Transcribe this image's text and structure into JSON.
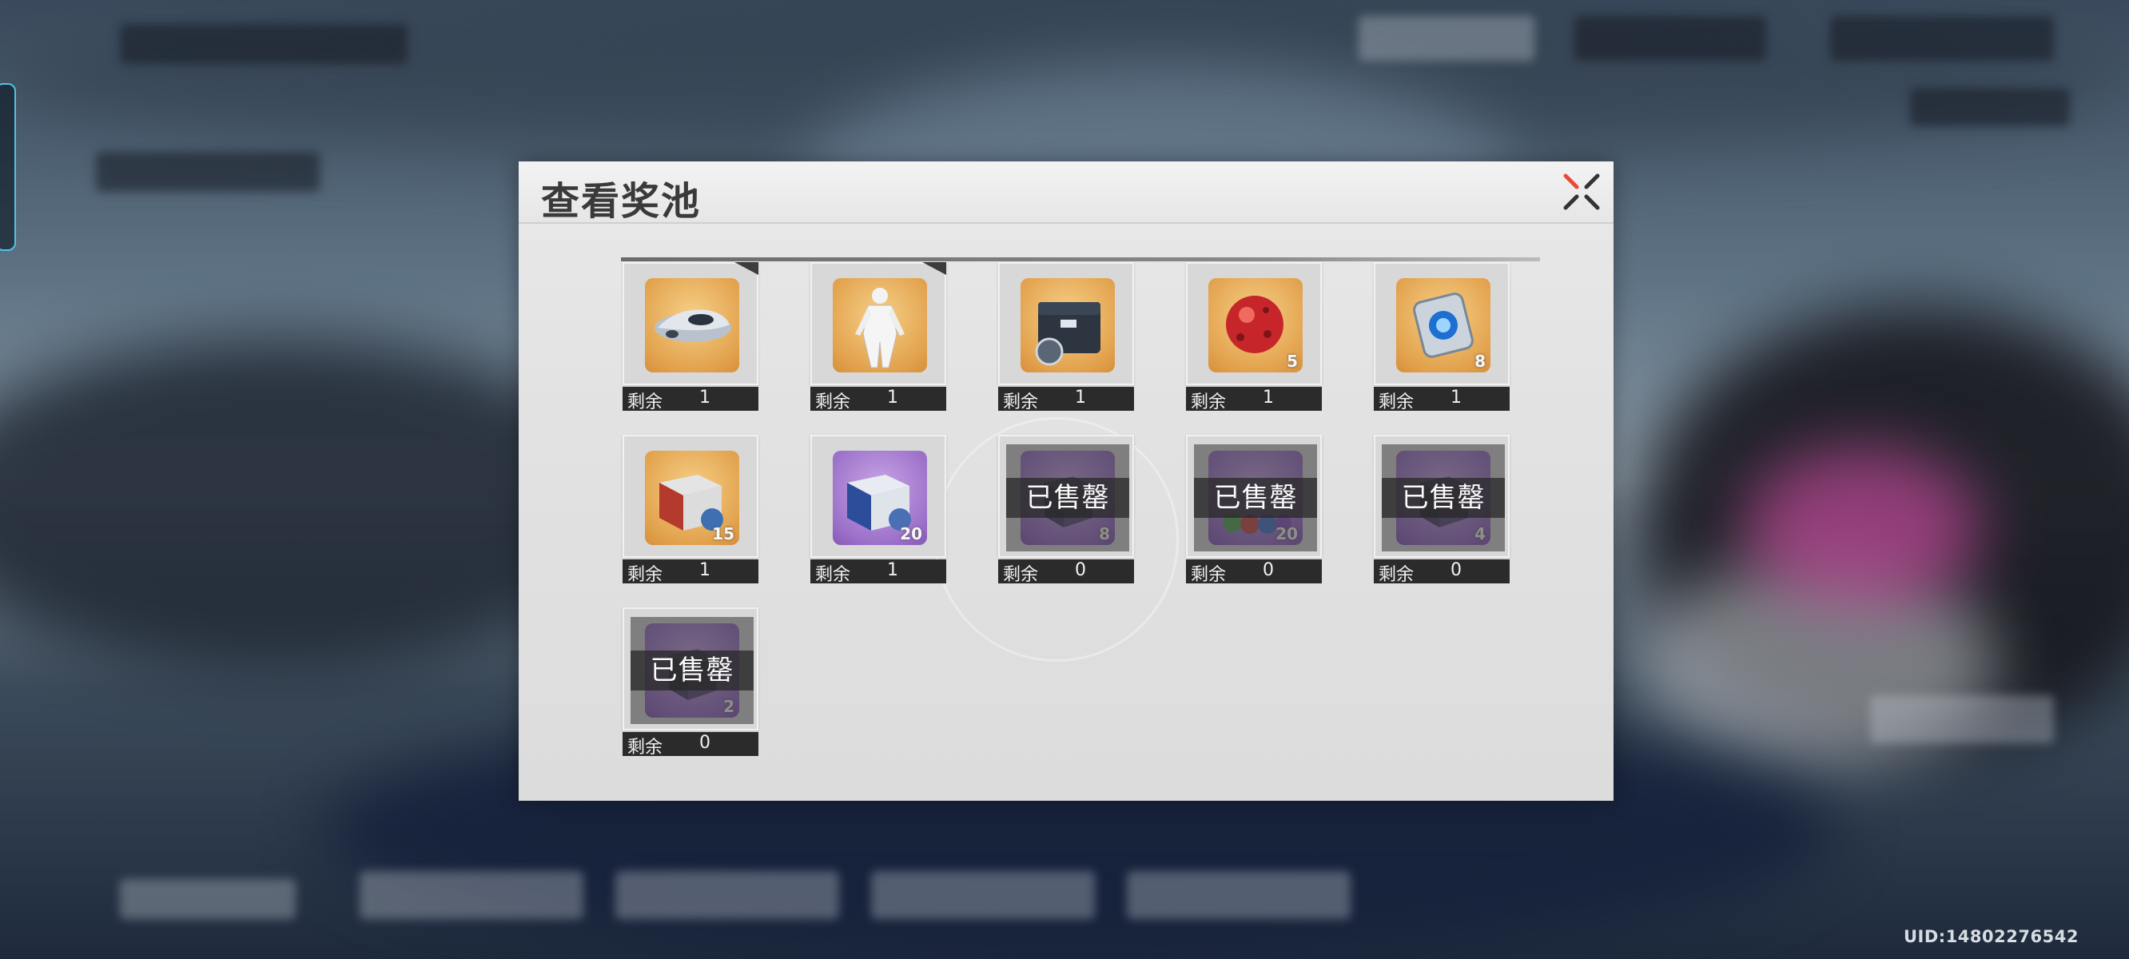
{
  "dialog": {
    "title": "查看奖池"
  },
  "remaining_label": "剩余",
  "sold_out_label": "已售罄",
  "items": [
    {
      "icon": "vehicle-icon",
      "tier": "gold",
      "remaining": "1",
      "count": "",
      "sold_out": false,
      "corner": true
    },
    {
      "icon": "outfit-icon",
      "tier": "gold",
      "remaining": "1",
      "count": "",
      "sold_out": false,
      "corner": true
    },
    {
      "icon": "supply-crate-icon",
      "tier": "gold",
      "remaining": "1",
      "count": "",
      "sold_out": false,
      "corner": false
    },
    {
      "icon": "red-orb-icon",
      "tier": "gold",
      "remaining": "1",
      "count": "5",
      "sold_out": false,
      "corner": false
    },
    {
      "icon": "blue-core-icon",
      "tier": "gold",
      "remaining": "1",
      "count": "8",
      "sold_out": false,
      "corner": false
    },
    {
      "icon": "red-box-icon",
      "tier": "gold",
      "remaining": "1",
      "count": "15",
      "sold_out": false,
      "corner": false
    },
    {
      "icon": "blue-box-icon",
      "tier": "purple",
      "remaining": "1",
      "count": "20",
      "sold_out": false,
      "corner": false
    },
    {
      "icon": "item-icon",
      "tier": "purple",
      "remaining": "0",
      "count": "8",
      "sold_out": true,
      "corner": false
    },
    {
      "icon": "gems-icon",
      "tier": "purple",
      "remaining": "0",
      "count": "20",
      "sold_out": true,
      "corner": false
    },
    {
      "icon": "item-icon",
      "tier": "purple",
      "remaining": "0",
      "count": "4",
      "sold_out": true,
      "corner": false
    },
    {
      "icon": "item-icon",
      "tier": "purple",
      "remaining": "0",
      "count": "2",
      "sold_out": true,
      "corner": false
    }
  ],
  "footer": {
    "uid": "UID:14802276542"
  },
  "colors": {
    "gold_tier": "#e2a24d",
    "purple_tier": "#9b70c9",
    "close_accent": "#e84a3a",
    "side_tab_border": "#52c3e6"
  }
}
